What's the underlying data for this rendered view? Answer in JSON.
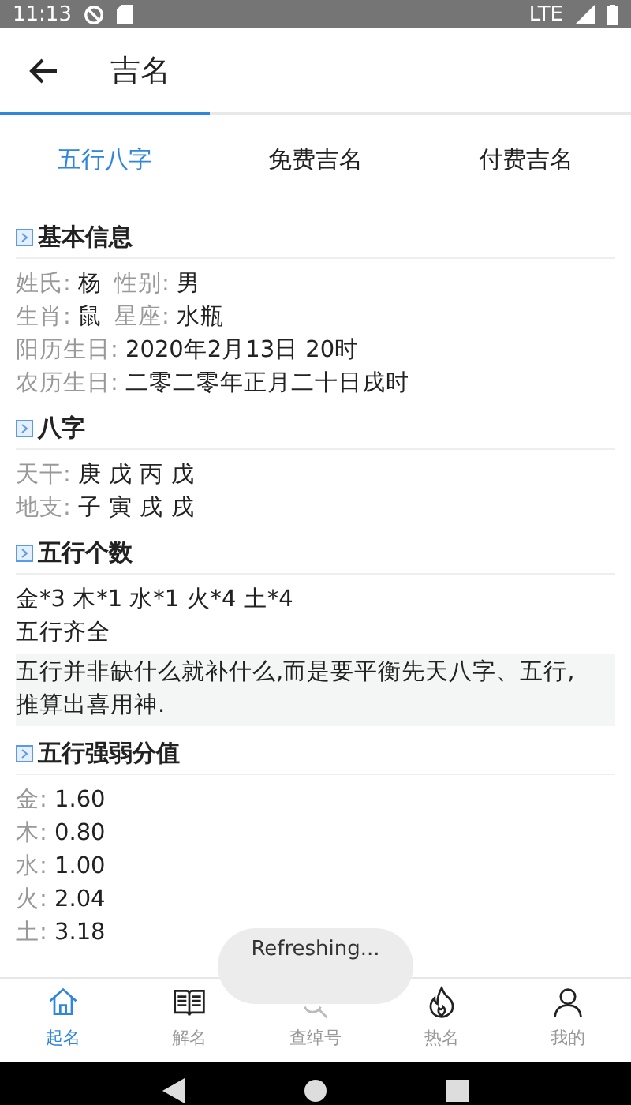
{
  "status_bar": {
    "time": "11:13",
    "network": "LTE"
  },
  "app_bar": {
    "title": "吉名"
  },
  "tabs": [
    {
      "label": "五行八字",
      "selected": true
    },
    {
      "label": "免费吉名",
      "selected": false
    },
    {
      "label": "付费吉名",
      "selected": false
    }
  ],
  "sections": [
    {
      "title": "基本信息",
      "lines": [
        {
          "kind": "fields",
          "items": [
            {
              "label": "姓氏:",
              "value": "杨"
            },
            {
              "label": "性别:",
              "value": "男"
            }
          ]
        },
        {
          "kind": "fields",
          "items": [
            {
              "label": "生肖:",
              "value": "鼠"
            },
            {
              "label": "星座:",
              "value": "水瓶"
            }
          ]
        },
        {
          "kind": "fields",
          "items": [
            {
              "label": "阳历生日:",
              "value": "2020年2月13日 20时"
            }
          ]
        },
        {
          "kind": "fields",
          "items": [
            {
              "label": "农历生日:",
              "value": "二零二零年正月二十日戌时"
            }
          ]
        }
      ]
    },
    {
      "title": "八字",
      "lines": [
        {
          "kind": "fields",
          "items": [
            {
              "label": "天干:",
              "value": "庚 戊 丙 戊"
            }
          ]
        },
        {
          "kind": "fields",
          "items": [
            {
              "label": "地支:",
              "value": "子 寅 戌 戌"
            }
          ]
        }
      ]
    },
    {
      "title": "五行个数",
      "lines": [
        {
          "kind": "text",
          "text": "金*3 木*1 水*1 火*4 土*4"
        },
        {
          "kind": "text",
          "text": "五行齐全"
        },
        {
          "kind": "note",
          "text": "五行并非缺什么就补什么,而是要平衡先天八字、五行,推算出喜用神."
        }
      ]
    },
    {
      "title": "五行强弱分值",
      "lines": [
        {
          "kind": "fields",
          "items": [
            {
              "label": "金:",
              "value": "1.60"
            }
          ]
        },
        {
          "kind": "fields",
          "items": [
            {
              "label": "木:",
              "value": "0.80"
            }
          ]
        },
        {
          "kind": "fields",
          "items": [
            {
              "label": "水:",
              "value": "1.00"
            }
          ]
        },
        {
          "kind": "fields",
          "items": [
            {
              "label": "火:",
              "value": "2.04"
            }
          ]
        },
        {
          "kind": "fields",
          "items": [
            {
              "label": "土:",
              "value": "3.18"
            }
          ]
        }
      ]
    }
  ],
  "bottom_nav": [
    {
      "label": "起名",
      "selected": true
    },
    {
      "label": "解名",
      "selected": false
    },
    {
      "label": "查绰号",
      "selected": false
    },
    {
      "label": "热名",
      "selected": false
    },
    {
      "label": "我的",
      "selected": false
    }
  ],
  "toast": "Refreshing..."
}
